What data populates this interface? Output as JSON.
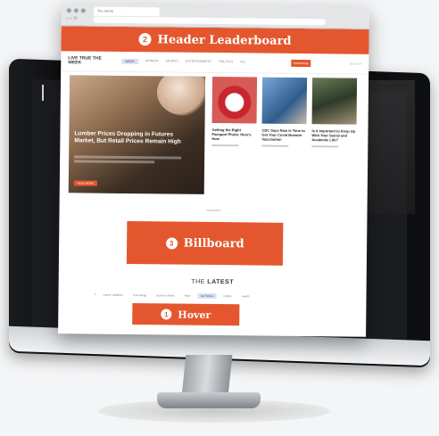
{
  "browser": {
    "tab_label": "The Week",
    "nav_icons": "‹ › ⟳"
  },
  "ads": {
    "leaderboard": {
      "number": "2",
      "label": "Header Leaderboard"
    },
    "billboard": {
      "number": "3",
      "label": "Billboard"
    },
    "hover": {
      "number": "1",
      "label": "Hover"
    }
  },
  "site": {
    "logo": "LIVE TRUE THE WEEK",
    "menu": [
      "NEWS",
      "OPINION",
      "SPORTS",
      "ENTERTAINMENT",
      "POLITICS",
      "ALL"
    ],
    "subscribe": "SUBSCRIBE",
    "utility": "SIGN IN  ≡"
  },
  "hero": {
    "title": "Lumber Prices Dropping in Futures Market, But Retail Prices Remain High",
    "tag": "READ MORE"
  },
  "cards": [
    {
      "title": "Getting the Right Passport Photo: Here's How"
    },
    {
      "title": "CDC Says Now is Time to Get Your Covid Booster Vaccination"
    },
    {
      "title": "Is it Important to Keep Up With Your Social and Academic Life?"
    }
  ],
  "latest": {
    "prefix": "THE",
    "label": "LATEST"
  },
  "pills": [
    "Latest Headlines",
    "Technology",
    "Business News",
    "Style",
    "Top Stories",
    "Politics",
    "Health"
  ],
  "colors": {
    "accent": "#e4572e",
    "monitor": "#0e0f11"
  }
}
